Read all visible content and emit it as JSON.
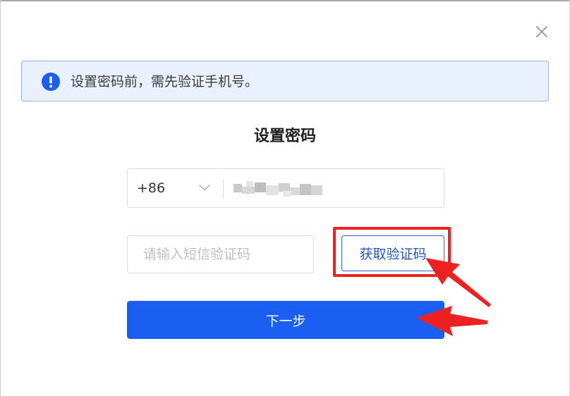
{
  "dialog": {
    "close_icon": "close-icon"
  },
  "alert": {
    "icon": "info-icon",
    "message": "设置密码前，需先验证手机号。",
    "colors": {
      "background": "#e9f1fe",
      "border": "#8db4ea",
      "icon": "#1b5ff2"
    }
  },
  "form": {
    "title": "设置密码",
    "phone": {
      "country_code": "+86",
      "dropdown_icon": "chevron-down-icon",
      "value": ""
    },
    "sms_code": {
      "placeholder": "请输入短信验证码",
      "value": ""
    },
    "get_code_label": "获取验证码",
    "next_label": "下一步"
  },
  "annotations": {
    "color": "#ee2020",
    "items": [
      "highlight-box",
      "arrow-to-get-code",
      "arrow-to-next"
    ]
  },
  "colors": {
    "primary": "#1b5ff2",
    "primary_text": "#1f56c4"
  }
}
